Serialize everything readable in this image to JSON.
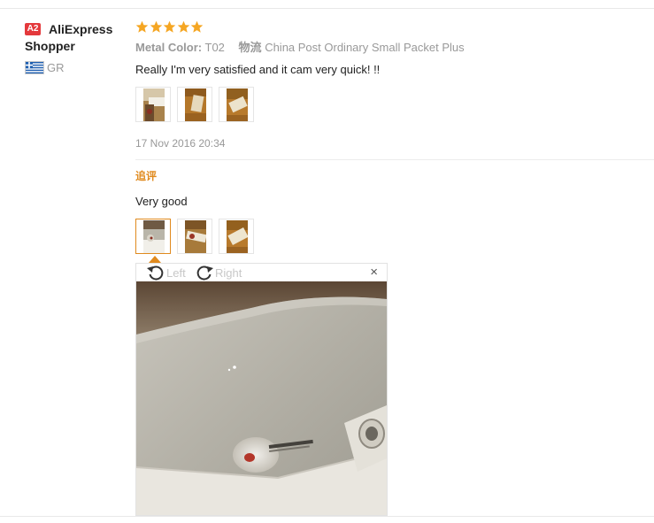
{
  "user": {
    "level_badge": "A2",
    "name": "AliExpress Shopper",
    "country": "GR"
  },
  "review": {
    "stars": 5,
    "rating_color": "#f5a623",
    "metal_color_label": "Metal Color:",
    "metal_color_value": "T02",
    "shipping_label": "物流",
    "shipping_value": "China Post Ordinary Small Packet Plus",
    "text": "Really I'm very satisfied and it cam very quick! !!",
    "date": "17 Nov 2016 20:34",
    "photos": 3
  },
  "additional": {
    "label": "追评",
    "text": "Very good",
    "photos": 3,
    "selected_photo": 1
  },
  "viewer": {
    "rotate_left_label": "Left",
    "rotate_right_label": "Right",
    "close_label": "×"
  }
}
